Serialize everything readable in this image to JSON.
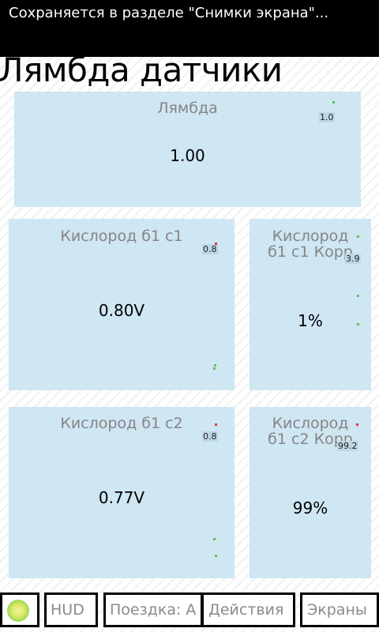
{
  "status_bar": {
    "text": "Сохраняется в разделе \"Снимки экрана\"..."
  },
  "page": {
    "title": "Лямбда датчики"
  },
  "tiles": [
    {
      "title": "Лямбда",
      "scale": "1.0",
      "value": "1.00"
    },
    {
      "title": "Кислород б1 с1",
      "scale": "0.8",
      "value": "0.80V"
    },
    {
      "title": "Кислород б1 с1 Корр",
      "title_line1": "Кислород",
      "title_line2": "б1 с1 Корр",
      "scale": "3.9",
      "value": "1%"
    },
    {
      "title": "Кислород б1 с2",
      "scale": "0.8",
      "value": "0.77V"
    },
    {
      "title": "Кислород б1 с2 Корр",
      "title_line1": "Кислород",
      "title_line2": "б1 с2 Корр",
      "scale": "99.2",
      "value": "99%"
    }
  ],
  "bottom_bar": {
    "hud_label": "HUD",
    "trip_label": "Поездка: А",
    "actions_label": "Действия",
    "screens_label": "Экраны"
  },
  "colors": {
    "tile_bg": "#cfe6f3",
    "indicator_green": "#5fbf5f",
    "indicator_red": "#d23c3c"
  },
  "icons": [
    "status-indicator-icon"
  ]
}
